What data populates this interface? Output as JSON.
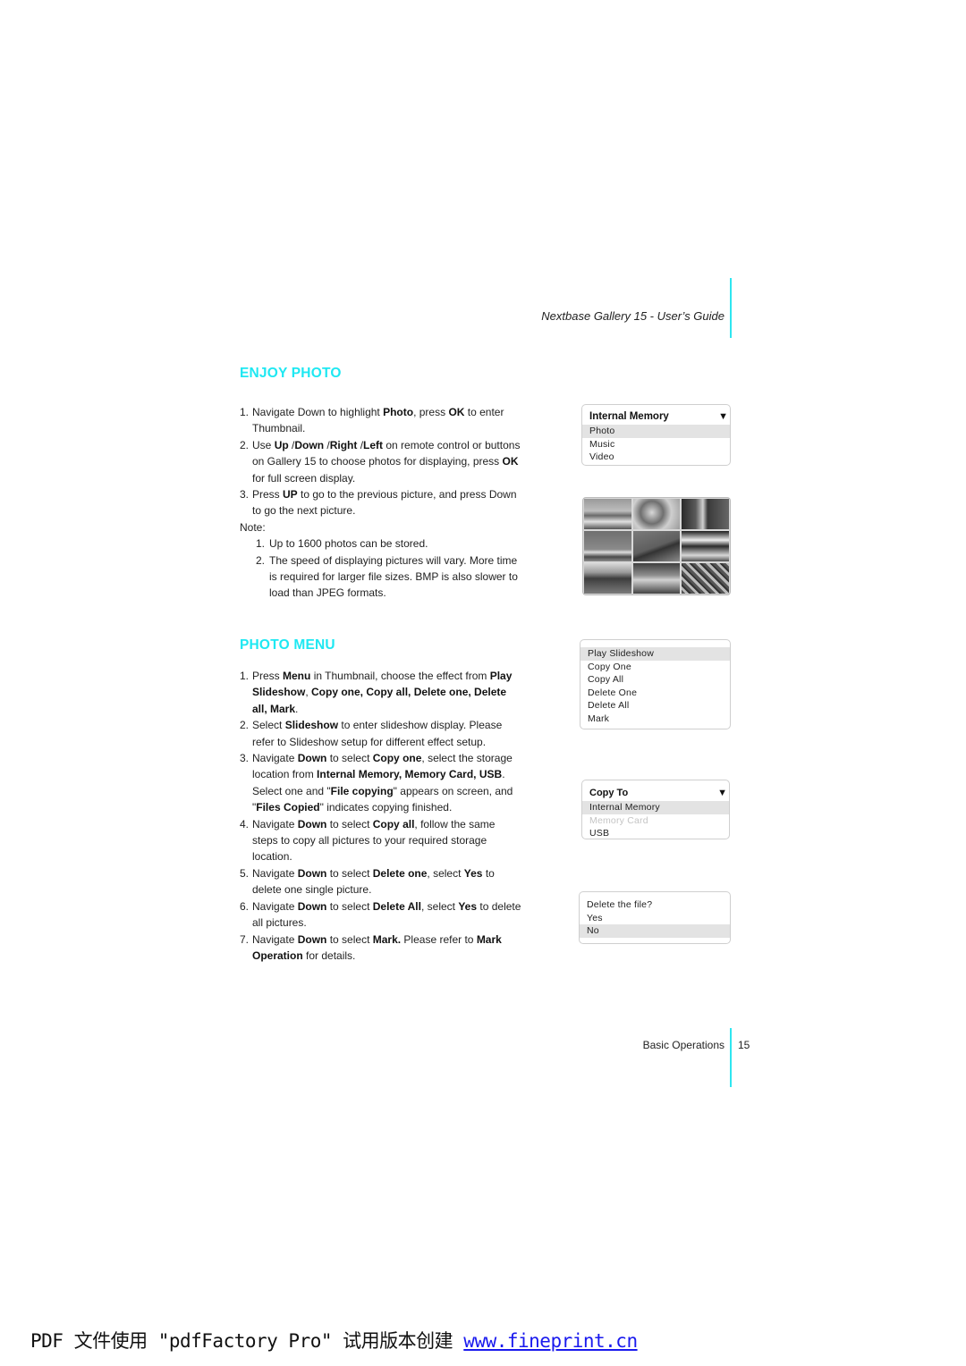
{
  "header": {
    "title": "Nextbase Gallery 15 - User’s Guide"
  },
  "accent_color": "#1ee8f2",
  "enjoy_photo": {
    "title": "ENJOY PHOTO",
    "steps": [
      {
        "num": "1.",
        "parts": [
          [
            "Navigate Down to highlight ",
            false
          ],
          [
            "Photo",
            true
          ],
          [
            ", press ",
            false
          ],
          [
            "OK",
            true
          ],
          [
            " to enter Thumbnail.",
            false
          ]
        ]
      },
      {
        "num": "2.",
        "parts": [
          [
            "Use ",
            false
          ],
          [
            "Up",
            true
          ],
          [
            " /",
            false
          ],
          [
            "Down",
            true
          ],
          [
            " /",
            false
          ],
          [
            "Right",
            true
          ],
          [
            " /",
            false
          ],
          [
            "Left",
            true
          ],
          [
            " on remote control or buttons on Gallery 15 to choose photos for displaying, press ",
            false
          ],
          [
            "OK",
            true
          ],
          [
            " for full screen display.",
            false
          ]
        ]
      },
      {
        "num": "3.",
        "parts": [
          [
            "Press ",
            false
          ],
          [
            "UP",
            true
          ],
          [
            " to go to the previous picture, and press Down to go the next picture.",
            false
          ]
        ]
      }
    ],
    "note_label": "Note:",
    "notes": [
      {
        "num": "1.",
        "text": "Up to 1600 photos can be stored."
      },
      {
        "num": "2.",
        "text": "The speed of displaying pictures will vary. More time is required for larger file sizes. BMP is also slower to load than JPEG formats."
      }
    ]
  },
  "photo_menu": {
    "title": "PHOTO MENU",
    "steps": [
      {
        "num": "1.",
        "parts": [
          [
            "Press ",
            false
          ],
          [
            "Menu",
            true
          ],
          [
            " in Thumbnail, choose the effect from ",
            false
          ],
          [
            "Play Slideshow",
            true
          ],
          [
            ", ",
            false
          ],
          [
            "Copy one, Copy all, Delete one, Delete all, Mark",
            true
          ],
          [
            ".",
            false
          ]
        ]
      },
      {
        "num": "2.",
        "parts": [
          [
            "Select ",
            false
          ],
          [
            "Slideshow",
            true
          ],
          [
            " to enter slideshow display. Please refer to Slideshow setup for different effect setup.",
            false
          ]
        ]
      },
      {
        "num": "3.",
        "parts": [
          [
            "Navigate ",
            false
          ],
          [
            "Down",
            true
          ],
          [
            " to select ",
            false
          ],
          [
            "Copy one",
            true
          ],
          [
            ", select the storage location from ",
            false
          ],
          [
            "Internal Memory, Memory Card, USB",
            true
          ],
          [
            ". Select one and \"",
            false
          ],
          [
            "File copying",
            true
          ],
          [
            "\" appears on screen, and \"",
            false
          ],
          [
            "Files Copied",
            true
          ],
          [
            "\" indicates copying finished.",
            false
          ]
        ]
      },
      {
        "num": "4.",
        "parts": [
          [
            "Navigate ",
            false
          ],
          [
            "Down",
            true
          ],
          [
            " to select ",
            false
          ],
          [
            "Copy all",
            true
          ],
          [
            ", follow the same steps to copy all pictures to your required storage location.",
            false
          ]
        ]
      },
      {
        "num": "5.",
        "parts": [
          [
            "Navigate ",
            false
          ],
          [
            "Down",
            true
          ],
          [
            " to select ",
            false
          ],
          [
            "Delete one",
            true
          ],
          [
            ", select ",
            false
          ],
          [
            "Yes",
            true
          ],
          [
            " to delete one single picture.",
            false
          ]
        ]
      },
      {
        "num": "6.",
        "parts": [
          [
            "Navigate ",
            false
          ],
          [
            "Down",
            true
          ],
          [
            " to select ",
            false
          ],
          [
            "Delete All",
            true
          ],
          [
            ", select ",
            false
          ],
          [
            "Yes",
            true
          ],
          [
            " to delete all pictures.",
            false
          ]
        ]
      },
      {
        "num": "7.",
        "parts": [
          [
            "Navigate ",
            false
          ],
          [
            "Down",
            true
          ],
          [
            " to select ",
            false
          ],
          [
            "Mark.",
            true
          ],
          [
            " Please refer to ",
            false
          ],
          [
            "Mark Operation",
            true
          ],
          [
            " for details.",
            false
          ]
        ]
      }
    ]
  },
  "panels": {
    "memory_menu": {
      "header": "Internal Memory",
      "arrow": "▼",
      "items": [
        "Photo",
        "Music",
        "Video"
      ],
      "selected": 0
    },
    "thumbnails": {
      "count": 9
    },
    "photo_menu": {
      "items": [
        "Play Slideshow",
        "Copy One",
        "Copy All",
        "Delete One",
        "Delete All",
        "Mark"
      ],
      "selected": 0
    },
    "copy_to": {
      "header": "Copy To",
      "arrow": "▼",
      "items": [
        "Internal Memory",
        "Memory Card",
        "USB"
      ],
      "selected": 0,
      "disabled": [
        1
      ]
    },
    "delete_confirm": {
      "prompt": "Delete the file?",
      "items": [
        "Yes",
        "No"
      ],
      "selected": 1
    }
  },
  "footer": {
    "section": "Basic Operations",
    "page": "15"
  },
  "watermark": {
    "text": "PDF 文件使用 \"pdfFactory Pro\" 试用版本创建 ",
    "link": "www.fineprint.cn"
  }
}
